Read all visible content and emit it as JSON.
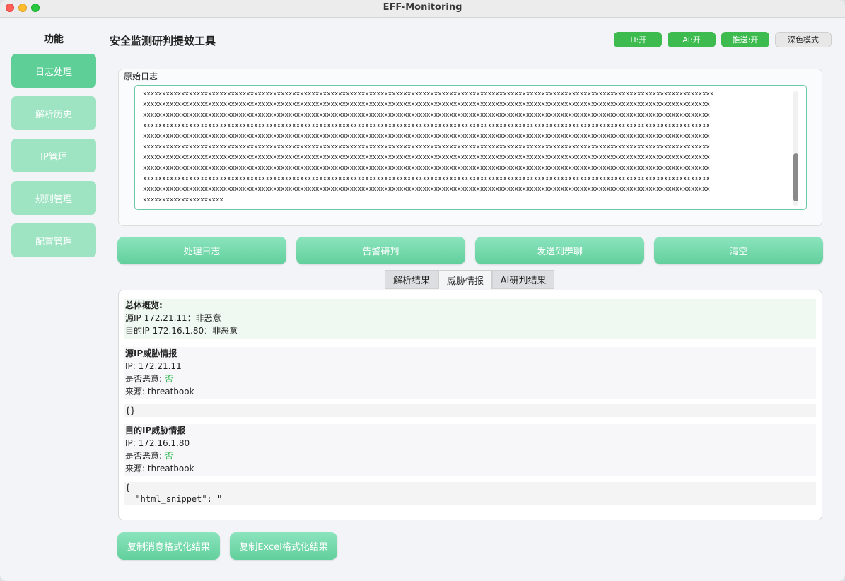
{
  "window": {
    "title": "EFF-Monitoring"
  },
  "sidebar": {
    "title": "功能",
    "items": [
      {
        "label": "日志处理"
      },
      {
        "label": "解析历史"
      },
      {
        "label": "IP管理"
      },
      {
        "label": "规则管理"
      },
      {
        "label": "配置管理"
      }
    ]
  },
  "header": {
    "title": "安全监测研判提效工具",
    "toggles": {
      "ti": "TI:开",
      "ai": "AI:开",
      "push": "推送:开",
      "dark": "深色模式"
    }
  },
  "log": {
    "label": "原始日志",
    "text": "xxxxxxxxxxxxxxxxxxxxxxxxxxxxxxxxxxxxxxxxxxxxxxxxxxxxxxxxxxxxxxxxxxxxxxxxxxxxxxxxxxxxxxxxxxxxxxxxxxxxxxxxxxxxxxxxxxxxxxxxxxxxxxxxxxxxxxxxxxxxxxxxxxxxx\nxxxxxxxxxxxxxxxxxxxxxxxxxxxxxxxxxxxxxxxxxxxxxxxxxxxxxxxxxxxxxxxxxxxxxxxxxxxxxxxxxxxxxxxxxxxxxxxxxxxxxxxxxxxxxxxxxxxxxxxxxxxxxxxxxxxxxxxxxxxxxxxxxxxx\nxxxxxxxxxxxxxxxxxxxxxxxxxxxxxxxxxxxxxxxxxxxxxxxxxxxxxxxxxxxxxxxxxxxxxxxxxxxxxxxxxxxxxxxxxxxxxxxxxxxxxxxxxxxxxxxxxxxxxxxxxxxxxxxxxxxxxxxxxxxxxxxxxxxx\nxxxxxxxxxxxxxxxxxxxxxxxxxxxxxxxxxxxxxxxxxxxxxxxxxxxxxxxxxxxxxxxxxxxxxxxxxxxxxxxxxxxxxxxxxxxxxxxxxxxxxxxxxxxxxxxxxxxxxxxxxxxxxxxxxxxxxxxxxxxxxxxxxxxx\nxxxxxxxxxxxxxxxxxxxxxxxxxxxxxxxxxxxxxxxxxxxxxxxxxxxxxxxxxxxxxxxxxxxxxxxxxxxxxxxxxxxxxxxxxxxxxxxxxxxxxxxxxxxxxxxxxxxxxxxxxxxxxxxxxxxxxxxxxxxxxxxxxxxx\nxxxxxxxxxxxxxxxxxxxxxxxxxxxxxxxxxxxxxxxxxxxxxxxxxxxxxxxxxxxxxxxxxxxxxxxxxxxxxxxxxxxxxxxxxxxxxxxxxxxxxxxxxxxxxxxxxxxxxxxxxxxxxxxxxxxxxxxxxxxxxxxxxxxx\nxxxxxxxxxxxxxxxxxxxxxxxxxxxxxxxxxxxxxxxxxxxxxxxxxxxxxxxxxxxxxxxxxxxxxxxxxxxxxxxxxxxxxxxxxxxxxxxxxxxxxxxxxxxxxxxxxxxxxxxxxxxxxxxxxxxxxxxxxxxxxxxxxxxx\nxxxxxxxxxxxxxxxxxxxxxxxxxxxxxxxxxxxxxxxxxxxxxxxxxxxxxxxxxxxxxxxxxxxxxxxxxxxxxxxxxxxxxxxxxxxxxxxxxxxxxxxxxxxxxxxxxxxxxxxxxxxxxxxxxxxxxxxxxxxxxxxxxxxx\nxxxxxxxxxxxxxxxxxxxxxxxxxxxxxxxxxxxxxxxxxxxxxxxxxxxxxxxxxxxxxxxxxxxxxxxxxxxxxxxxxxxxxxxxxxxxxxxxxxxxxxxxxxxxxxxxxxxxxxxxxxxxxxxxxxxxxxxxxxxxxxxxxxxx\nxxxxxxxxxxxxxxxxxxxxxxxxxxxxxxxxxxxxxxxxxxxxxxxxxxxxxxxxxxxxxxxxxxxxxxxxxxxxxxxxxxxxxxxxxxxxxxxxxxxxxxxxxxxxxxxxxxxxxxxxxxxxxxxxxxxxxxxxxxxxxxxxxxxx\nxxxxxxxxxxxxxxxxxxxxx"
  },
  "actions": {
    "process": "处理日志",
    "judge": "告警研判",
    "send": "发送到群聊",
    "clear": "清空"
  },
  "tabs": [
    {
      "label": "解析结果"
    },
    {
      "label": "威胁情报"
    },
    {
      "label": "AI研判结果"
    }
  ],
  "threat": {
    "overview": {
      "title": "总体概览:",
      "src_line": "源IP 172.21.11：非恶意",
      "dst_line": "目的IP 172.16.1.80：非恶意"
    },
    "src": {
      "title": "源IP威胁情报",
      "ip_line": "IP: 172.21.11",
      "malicious_label": "是否恶意: ",
      "malicious_value": "否",
      "source_line": "来源: threatbook",
      "raw": "{}"
    },
    "dst": {
      "title": "目的IP威胁情报",
      "ip_line": "IP: 172.16.1.80",
      "malicious_label": "是否恶意: ",
      "malicious_value": "否",
      "source_line": "来源: threatbook",
      "raw": "{\n  \"html_snippet\": \""
    }
  },
  "copy": {
    "message": "复制消息格式化结果",
    "excel": "复制Excel格式化结果"
  }
}
